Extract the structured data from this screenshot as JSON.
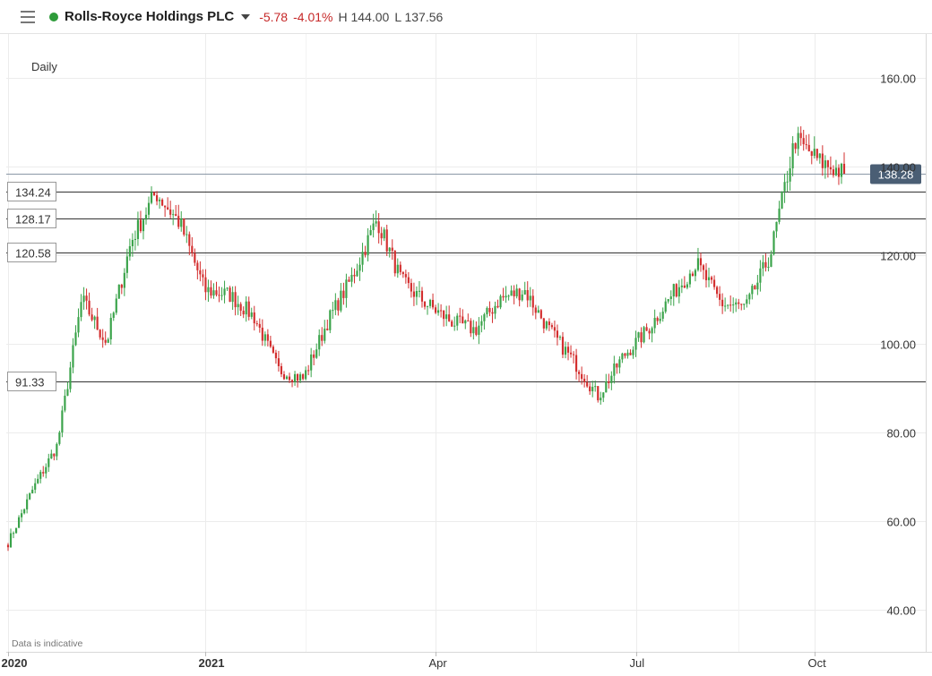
{
  "header": {
    "menu_icon": "hamburger-menu-icon",
    "instrument": "Rolls-Royce Holdings PLC",
    "live_color": "#2e9b3a",
    "change": "-5.78",
    "change_pct": "-4.01%",
    "high_label": "H",
    "high": "144.00",
    "low_label": "L",
    "low": "137.56"
  },
  "chart_data": {
    "type": "candlestick",
    "interval_label": "Daily",
    "footnote": "Data is indicative",
    "ylim": [
      30,
      170
    ],
    "y_ticks": [
      "160.00",
      "140.00",
      "120.00",
      "100.00",
      "80.00",
      "60.00",
      "40.00"
    ],
    "y_tick_values": [
      160,
      140,
      120,
      100,
      80,
      60,
      40
    ],
    "x_ticks": [
      {
        "label": "2020",
        "bold": true,
        "index": 0
      },
      {
        "label": "2021",
        "bold": true,
        "index": 73
      },
      {
        "label": "Apr",
        "bold": false,
        "index": 158
      },
      {
        "label": "Jul",
        "bold": false,
        "index": 232
      },
      {
        "label": "Oct",
        "bold": false,
        "index": 298
      }
    ],
    "current_price": "138.28",
    "current_value": 138.28,
    "level_lines": [
      {
        "label": "134.24",
        "value": 134.24
      },
      {
        "label": "128.17",
        "value": 128.17
      },
      {
        "label": "120.58",
        "value": 120.58
      },
      {
        "label": "91.33",
        "value": 91.33
      }
    ],
    "colors": {
      "up": "#3aa34a",
      "down": "#d32f2f",
      "price_tag": "#4a5e74"
    },
    "points": [
      {
        "date": "2020-11",
        "close": 55
      },
      {
        "date": "2020-11",
        "close": 67
      },
      {
        "date": "2020-12",
        "close": 77
      },
      {
        "date": "2020-12",
        "close": 110
      },
      {
        "date": "2020-12",
        "close": 100
      },
      {
        "date": "2021-01",
        "close": 123
      },
      {
        "date": "2021-01",
        "close": 134
      },
      {
        "date": "2021-01",
        "close": 127
      },
      {
        "date": "2021-02",
        "close": 112
      },
      {
        "date": "2021-02",
        "close": 111
      },
      {
        "date": "2021-02",
        "close": 106
      },
      {
        "date": "2021-03",
        "close": 94
      },
      {
        "date": "2021-03",
        "close": 92
      },
      {
        "date": "2021-03",
        "close": 105
      },
      {
        "date": "2021-03",
        "close": 115
      },
      {
        "date": "2021-03",
        "close": 128
      },
      {
        "date": "2021-04",
        "close": 114
      },
      {
        "date": "2021-04",
        "close": 109
      },
      {
        "date": "2021-05",
        "close": 105
      },
      {
        "date": "2021-05",
        "close": 103
      },
      {
        "date": "2021-06",
        "close": 110
      },
      {
        "date": "2021-06",
        "close": 112
      },
      {
        "date": "2021-06",
        "close": 103
      },
      {
        "date": "2021-07",
        "close": 96
      },
      {
        "date": "2021-07",
        "close": 88
      },
      {
        "date": "2021-08",
        "close": 97
      },
      {
        "date": "2021-08",
        "close": 103
      },
      {
        "date": "2021-08",
        "close": 111
      },
      {
        "date": "2021-09",
        "close": 118
      },
      {
        "date": "2021-09",
        "close": 109
      },
      {
        "date": "2021-09",
        "close": 108
      },
      {
        "date": "2021-09",
        "close": 120
      },
      {
        "date": "2021-09",
        "close": 146
      },
      {
        "date": "2021-10",
        "close": 141
      },
      {
        "date": "2021-10",
        "close": 138.28
      }
    ]
  }
}
